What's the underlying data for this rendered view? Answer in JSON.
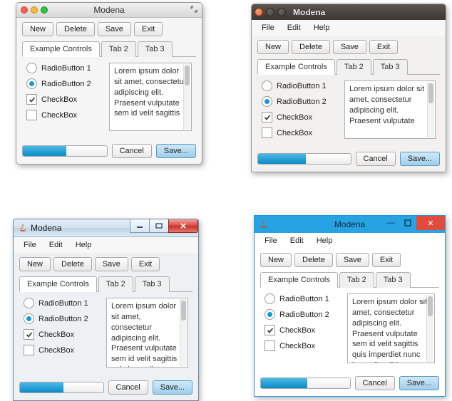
{
  "title": "Modena",
  "menubar": {
    "file": "File",
    "edit": "Edit",
    "help": "Help"
  },
  "toolbar": {
    "new": "New",
    "delete": "Delete",
    "save": "Save",
    "exit": "Exit"
  },
  "tabs": {
    "t1": "Example Controls",
    "t2": "Tab 2",
    "t3": "Tab 3"
  },
  "controls": {
    "radio1": "RadioButton 1",
    "radio2": "RadioButton 2",
    "check1": "CheckBox",
    "check2": "CheckBox"
  },
  "text_short": "Lorem ipsum dolor sit amet, consectetur adipiscing elit. Praesent vulputate sem id velit sagittis",
  "text_ubu": "Lorem ipsum dolor sit amet, consectetur adipiscing elit. Praesent vulputate",
  "text_long": "Lorem ipsum dolor sit amet, consectetur adipiscing elit. Praesent vulputate sem id velit sagittis quis imperdiet nunc imperdiet. Etiam",
  "footer": {
    "cancel": "Cancel",
    "save": "Save..."
  }
}
